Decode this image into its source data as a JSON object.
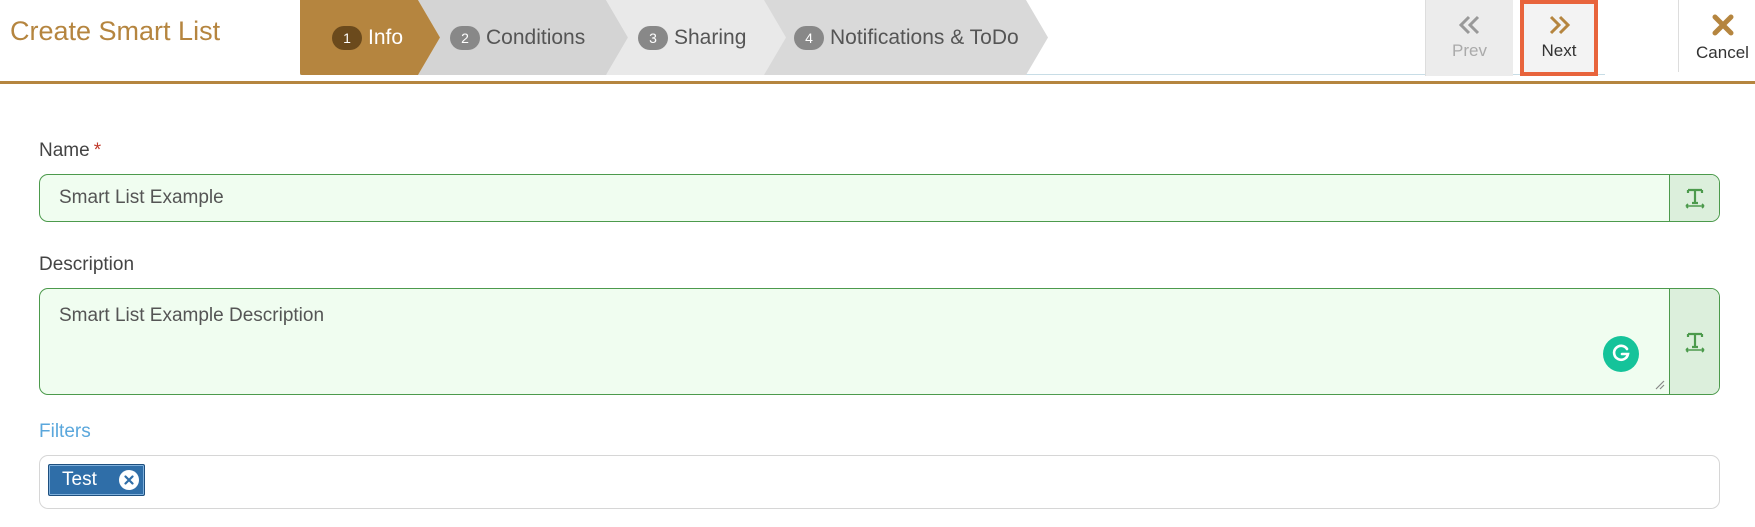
{
  "header": {
    "title": "Create Smart List"
  },
  "wizard": {
    "steps": [
      {
        "number": "1",
        "label": "Info",
        "active": true
      },
      {
        "number": "2",
        "label": "Conditions",
        "active": false
      },
      {
        "number": "3",
        "label": "Sharing",
        "active": false
      },
      {
        "number": "4",
        "label": "Notifications & ToDo",
        "active": false
      }
    ]
  },
  "toolbar": {
    "prev_label": "Prev",
    "next_label": "Next",
    "cancel_label": "Cancel",
    "prev_icon": "double-chevron-left-icon",
    "next_icon": "double-chevron-right-icon",
    "cancel_icon": "close-icon"
  },
  "form": {
    "name": {
      "label": "Name",
      "required_mark": "*",
      "value": "Smart List Example",
      "addon_icon": "text-format-icon"
    },
    "description": {
      "label": "Description",
      "value": "Smart List Example Description",
      "addon_icon": "text-format-icon"
    },
    "filters": {
      "label": "Filters",
      "tags": [
        "Test"
      ]
    }
  },
  "colors": {
    "accent": "#b5853f",
    "field_border": "#4c9a4c",
    "field_bg": "#f0fdf0",
    "filters_label": "#5aa7dc",
    "tag_bg": "#2f6ea8",
    "highlight": "#e8643c",
    "grammarly": "#15c39a"
  }
}
